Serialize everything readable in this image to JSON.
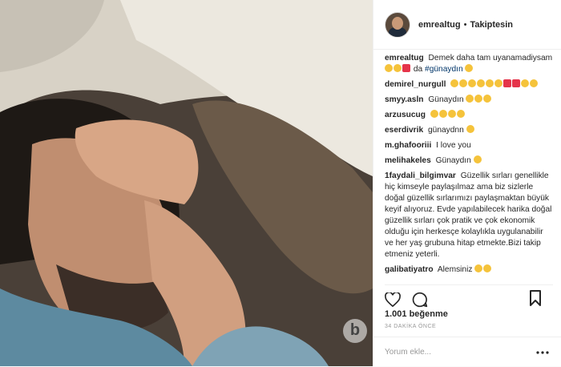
{
  "post": {
    "username": "emrealtug",
    "separator": "•",
    "follow_label": "Takiptesin",
    "caption_user": "emrealtug",
    "caption_text": "Demek daha tam uyanamadiysam",
    "caption_tail": "da",
    "caption_tag": "#günaydın",
    "likes": "1.001 beğenme",
    "time": "34 DAKİKA ÖNCE",
    "comment_placeholder": "Yorum ekle...",
    "more_icon": "more-dots-icon"
  },
  "comments": [
    {
      "user": "demirel_nurgull",
      "text": ""
    },
    {
      "user": "smyy.asln",
      "text": "Günaydın"
    },
    {
      "user": "arzusucug",
      "text": ""
    },
    {
      "user": "eserdivrik",
      "text": "günaydnn"
    },
    {
      "user": "m.ghafooriii",
      "text": "I love you"
    },
    {
      "user": "melihakeles",
      "text": "Günaydın"
    },
    {
      "user": "1faydali_bilgimvar",
      "text": "Güzellik sırları genellikle hiç kimseyle paylaşılmaz ama biz sizlerle doğal güzellik sırlarımızı paylaşmaktan büyük keyif alıyoruz. Evde yapılabilecek harika doğal güzellik sırları çok pratik ve çok ekonomik olduğu için herkesçe kolaylıkla uygulanabilir ve her yaş grubuna hitap etmekte.Bizi takip etmeniz yeterli."
    },
    {
      "user": "galibatiyatro",
      "text": "Alemsiniz"
    }
  ],
  "watermark": "b",
  "colors": {
    "accent": "#262626",
    "hashtag": "#003569",
    "muted": "#999999"
  }
}
